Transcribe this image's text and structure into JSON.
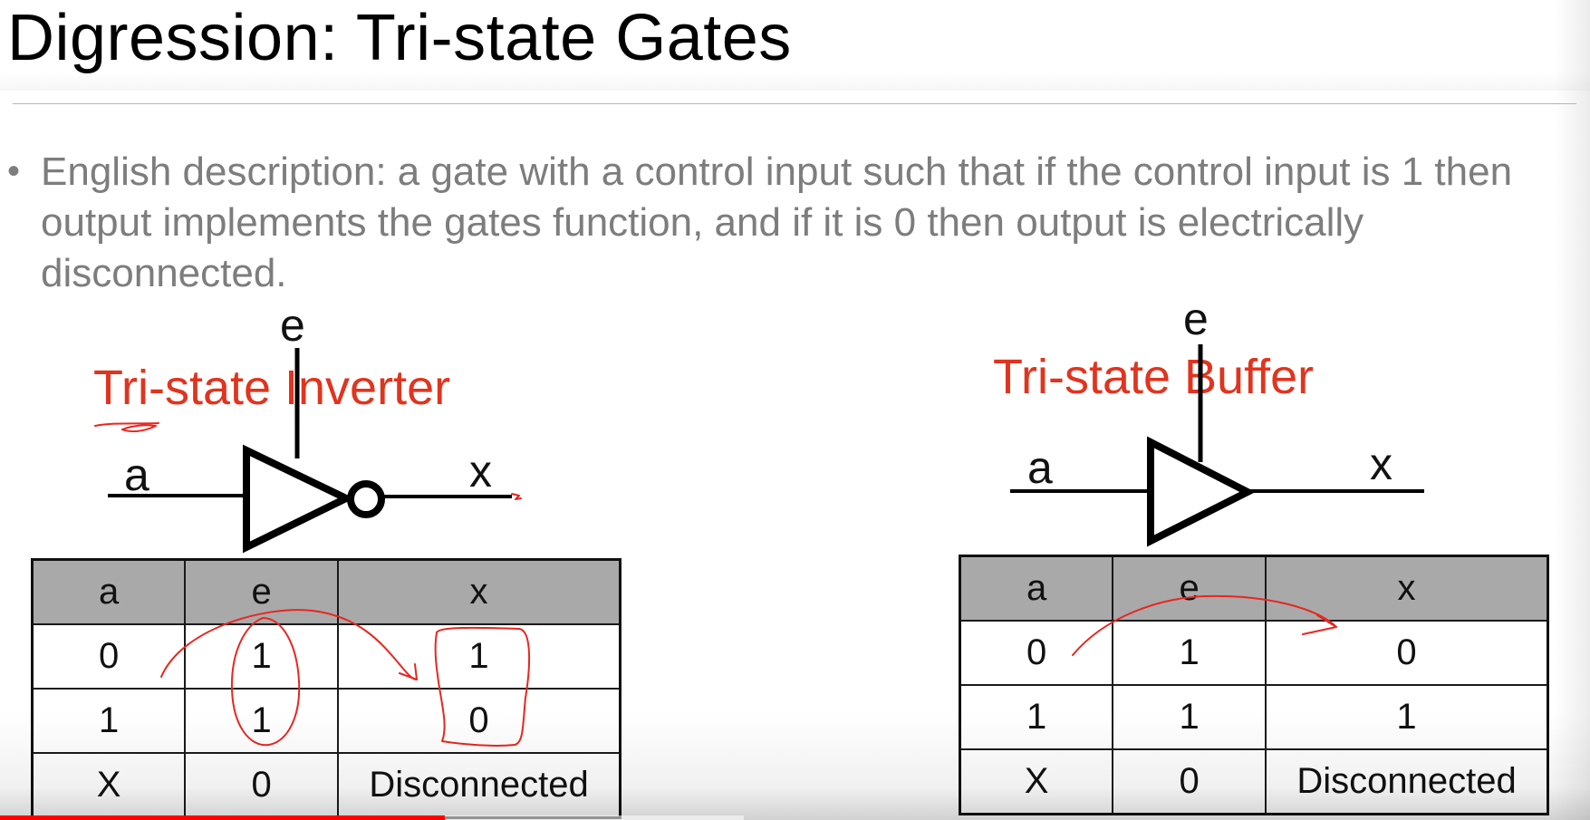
{
  "slide": {
    "title": "Digression: Tri-state Gates",
    "bullet_symbol": "•",
    "description": "English description: a gate with a control input such that if the control input is 1 then output implements the gates function, and if it is 0 then output is electrically disconnected."
  },
  "inverter": {
    "label": "Tri-state Inverter",
    "input_label": "a",
    "enable_label": "e",
    "output_label": "x",
    "table": {
      "headers": [
        "a",
        "e",
        "x"
      ],
      "rows": [
        [
          "0",
          "1",
          "1"
        ],
        [
          "1",
          "1",
          "0"
        ],
        [
          "X",
          "0",
          "Disconnected"
        ]
      ]
    }
  },
  "buffer": {
    "label": "Tri-state Buffer",
    "input_label": "a",
    "enable_label": "e",
    "output_label": "x",
    "table": {
      "headers": [
        "a",
        "e",
        "x"
      ],
      "rows": [
        [
          "0",
          "1",
          "0"
        ],
        [
          "1",
          "1",
          "1"
        ],
        [
          "X",
          "0",
          "Disconnected"
        ]
      ]
    }
  },
  "video_progress": {
    "played_fraction": 0.28
  },
  "colors": {
    "accent_red": "#e1341e",
    "body_gray": "#7d7d7d",
    "header_gray": "#a9a9a9",
    "ink_red": "#e8261f"
  }
}
